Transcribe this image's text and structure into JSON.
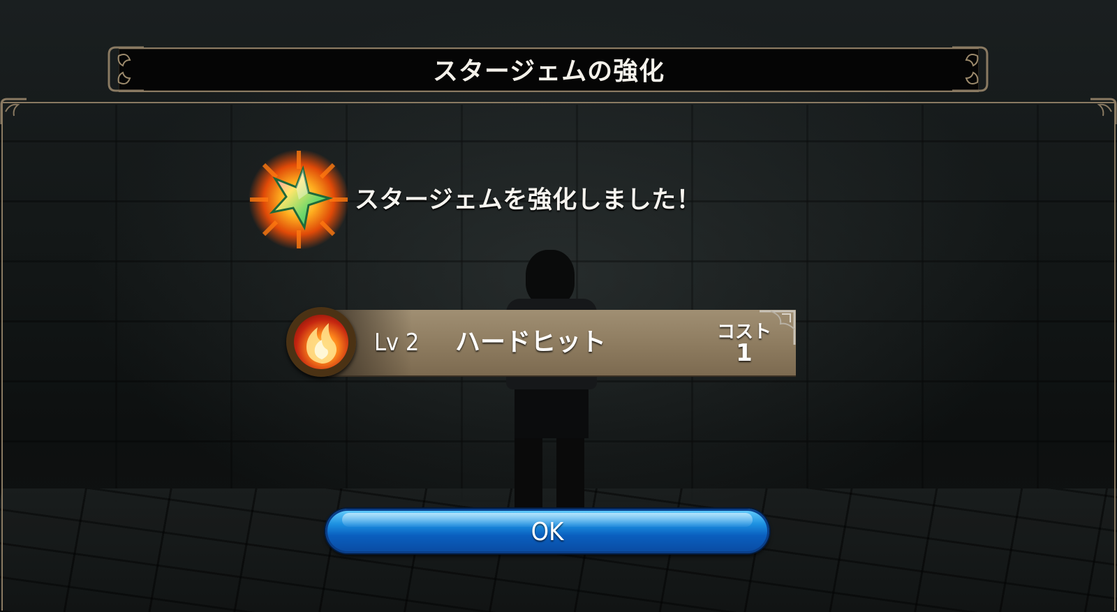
{
  "dialog": {
    "title": "スタージェムの強化",
    "message": "スタージェムを強化しました！"
  },
  "skill": {
    "level": "Lv 2",
    "name": "ハードヒット",
    "cost_label": "コスト",
    "cost_value": "1",
    "icon": "fire-icon"
  },
  "gem": {
    "icon": "star-gem-icon"
  },
  "buttons": {
    "ok_label": "OK"
  },
  "colors": {
    "frame_gold": "#8a7a62",
    "plate_tan": "#8d7b5f",
    "button_blue": "#1c8fe0",
    "title_bg": "#050505"
  }
}
